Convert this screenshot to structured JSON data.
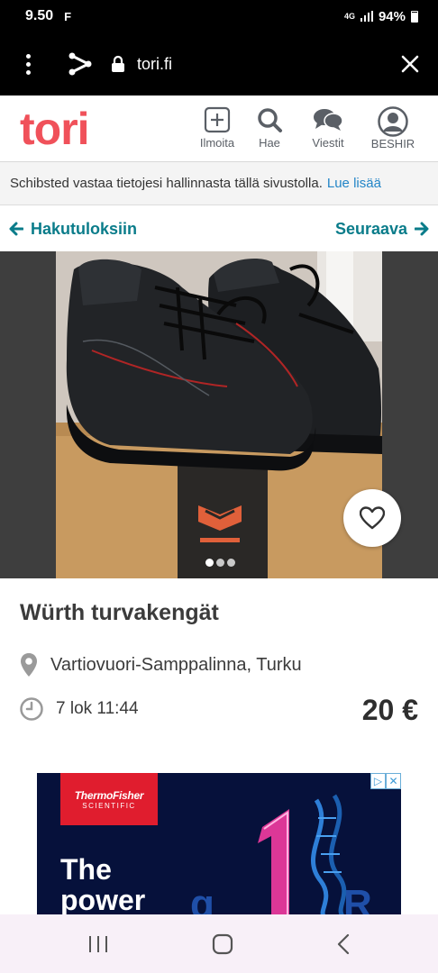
{
  "status_bar": {
    "time": "9.50",
    "carrier_icon": "F",
    "network": "4G",
    "battery": "94%"
  },
  "browser": {
    "url": "tori.fi"
  },
  "header": {
    "logo": "tori",
    "nav": [
      {
        "label": "Ilmoita",
        "icon": "plus-square-icon"
      },
      {
        "label": "Hae",
        "icon": "search-icon"
      },
      {
        "label": "Viestit",
        "icon": "chat-icon"
      },
      {
        "label": "BESHIR",
        "icon": "user-icon"
      }
    ]
  },
  "notice": {
    "text": "Schibsted vastaa tietojesi hallinnasta tällä sivustolla.",
    "link": "Lue lisää"
  },
  "result_nav": {
    "back": "Hakutuloksiin",
    "next": "Seuraava"
  },
  "gallery": {
    "image_count": 3,
    "active_index": 0
  },
  "listing": {
    "title": "Würth turvakengät",
    "location": "Vartiovuori-Samppalinna, Turku",
    "date": "7 lok 11:44",
    "price": "20 €"
  },
  "ad": {
    "brand_line1": "ThermoFisher",
    "brand_line2": "SCIENTIFIC",
    "headline_line1": "The",
    "headline_line2": "power"
  },
  "colors": {
    "brand": "#f0515a",
    "teal_link": "#0a7c8a",
    "notice_link": "#2385c7"
  }
}
